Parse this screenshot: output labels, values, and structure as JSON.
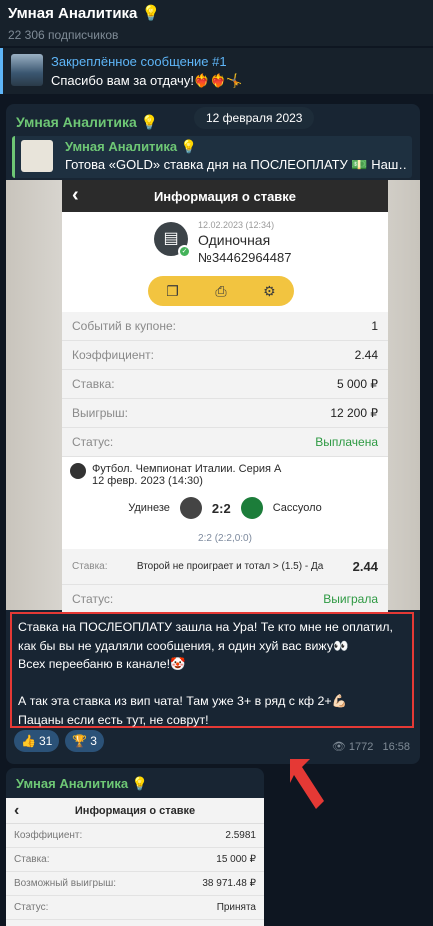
{
  "channel": {
    "name": "Умная Аналитика 💡",
    "subscribers": "22 306 подписчиков"
  },
  "pinned": {
    "title": "Закреплённое сообщение #1",
    "text": "Спасибо вам за отдачу!❤️‍🔥❤️‍🔥🤸"
  },
  "date_pill": "12 февраля 2023",
  "post": {
    "author": "Умная Аналитика 💡",
    "reply": {
      "author": "Умная Аналитика 💡",
      "text": "Готова «GOLD» ставка дня на ПОСЛЕОПЛАТУ 💵 Наш…"
    },
    "screenshot": {
      "title": "Информация о ставке",
      "date": "12.02.2023 (12:34)",
      "type": "Одиночная",
      "number": "№34462964487",
      "rows": [
        {
          "label": "Событий в купоне:",
          "value": "1"
        },
        {
          "label": "Коэффициент:",
          "value": "2.44"
        },
        {
          "label": "Ставка:",
          "value": "5 000 ₽"
        },
        {
          "label": "Выигрыш:",
          "value": "12 200 ₽"
        },
        {
          "label": "Статус:",
          "value": "Выплачена"
        }
      ],
      "match": {
        "league": "Футбол. Чемпионат Италии. Серия А",
        "datetime": "12 февр. 2023 (14:30)",
        "home": "Удинезе",
        "score": "2:2",
        "away": "Сассуоло",
        "halves": "2:2 (2:2,0:0)"
      },
      "bet": {
        "label": "Ставка:",
        "text": "Второй не проиграет и тотал > (1.5) - Да",
        "odds": "2.44"
      },
      "status": {
        "label": "Статус:",
        "value": "Выиграла"
      }
    },
    "text_lines": [
      "Ставка на ПОСЛЕОПЛАТУ зашла на Ура! Те кто мне не оплатил,",
      "как бы вы не удаляли сообщения, я один хуй вас вижу👀",
      "Всех переебаню в канале!🤡",
      "",
      "А так эта ставка из вип чата! Там уже 3+ в ряд с кф 2+💪🏻",
      "Пацаны если есть тут, не соврут!"
    ],
    "reactions": [
      {
        "emoji": "👍",
        "count": "31"
      },
      {
        "emoji": "🏆",
        "count": "3"
      }
    ],
    "views": "1772",
    "time": "16:58"
  },
  "post2": {
    "author": "Умная Аналитика 💡",
    "screenshot": {
      "title": "Информация о ставке",
      "rows": [
        {
          "label": "Коэффициент:",
          "value": "2.5981"
        },
        {
          "label": "Ставка:",
          "value": "15 000 ₽"
        },
        {
          "label": "Возможный выигрыш:",
          "value": "38 971.48 ₽"
        },
        {
          "label": "Статус:",
          "value": "Принята"
        }
      ]
    }
  },
  "colors": {
    "accent_blue": "#5eb5f7",
    "author_green": "#6ec775",
    "highlight_red": "#e53935",
    "won_green": "#2e9a43"
  }
}
